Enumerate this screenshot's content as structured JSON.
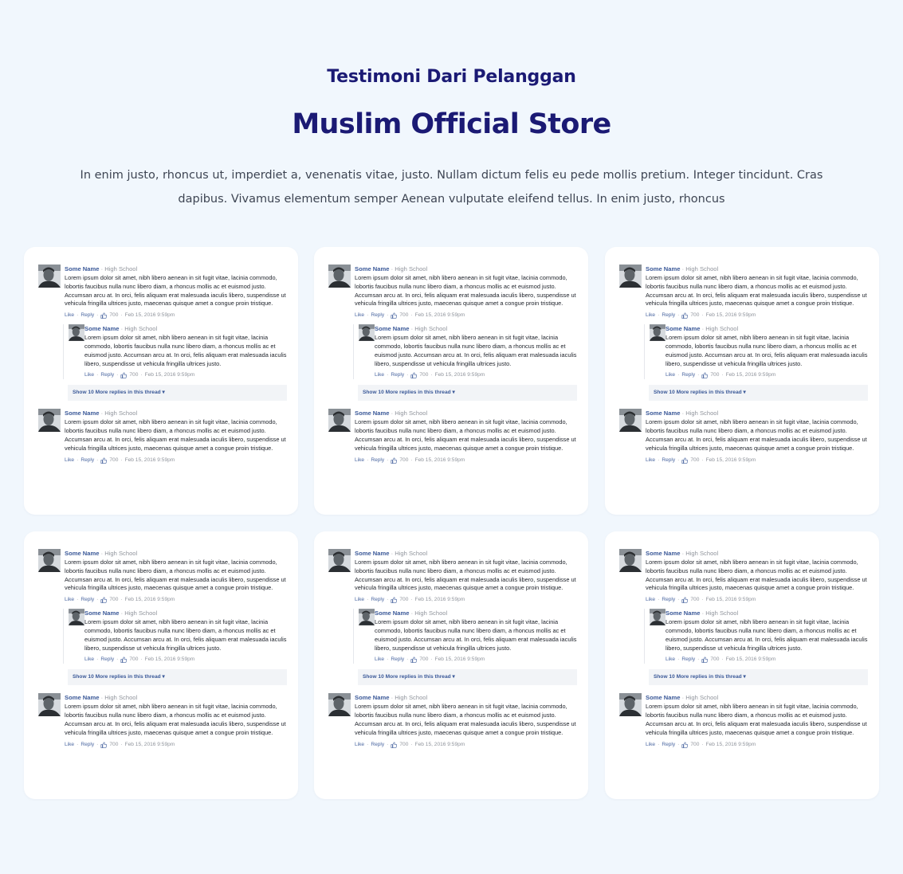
{
  "header": {
    "eyebrow": "Testimoni Dari Pelanggan",
    "title": "Muslim Official Store",
    "description": "In enim justo, rhoncus ut, imperdiet a, venenatis vitae, justo. Nullam dictum felis eu pede mollis pretium. Integer tincidunt. Cras dapibus. Vivamus elementum semper Aenean vulputate eleifend tellus. In enim justo, rhoncus"
  },
  "comment": {
    "name": "Some Name",
    "separator": "·",
    "school": "High School",
    "body": "Lorem ipsum dolor sit amet, nibh libero aenean in sit fugit vitae, lacinia commodo, lobortis faucibus nulla nunc libero diam, a rhoncus mollis ac et euismod justo. Accumsan arcu at. In orci, felis aliquam erat malesuada iaculis libero, suspendisse ut vehicula fringilla ultrices justo, maecenas quisque amet a congue proin tristique.",
    "reply_body": "Lorem ipsum dolor sit amet, nibh libero aenean in sit fugit vitae, lacinia commodo, lobortis faucibus nulla nunc libero diam, a rhoncus mollis ac et euismod justo. Accumsan arcu at. In orci, felis aliquam erat malesuada iaculis libero, suspendisse ut vehicula fringilla ultrices justo.",
    "like_label": "Like",
    "reply_label": "Reply",
    "like_count": "700",
    "timestamp": "Feb 15, 2016 9:59pm",
    "more_replies": "Show 10 More replies in this thread ▾",
    "like_icon": "thumbs-up-icon",
    "avatar_icon": "profile-photo"
  },
  "colors": {
    "page_background": "#f1f7fd",
    "heading": "#1b1a74",
    "name_link": "#3b5998"
  }
}
